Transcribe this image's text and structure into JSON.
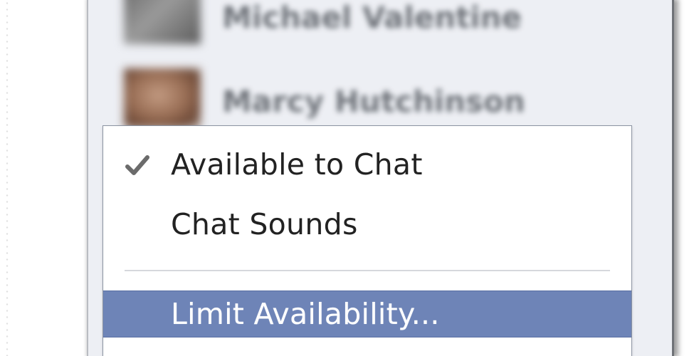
{
  "chat_panel": {
    "friends": [
      {
        "name": "Michael Valentine",
        "avatar_icon": "user-avatar-grey"
      },
      {
        "name": "Marcy Hutchinson",
        "avatar_icon": "user-avatar-photo"
      }
    ]
  },
  "menu": {
    "items": [
      {
        "label": "Available to Chat",
        "checked": true,
        "check_icon": "checkmark-icon"
      },
      {
        "label": "Chat Sounds",
        "checked": false
      },
      {
        "label": "Limit Availability...",
        "highlighted": true
      }
    ],
    "highlight_color": "#6e84b7"
  }
}
